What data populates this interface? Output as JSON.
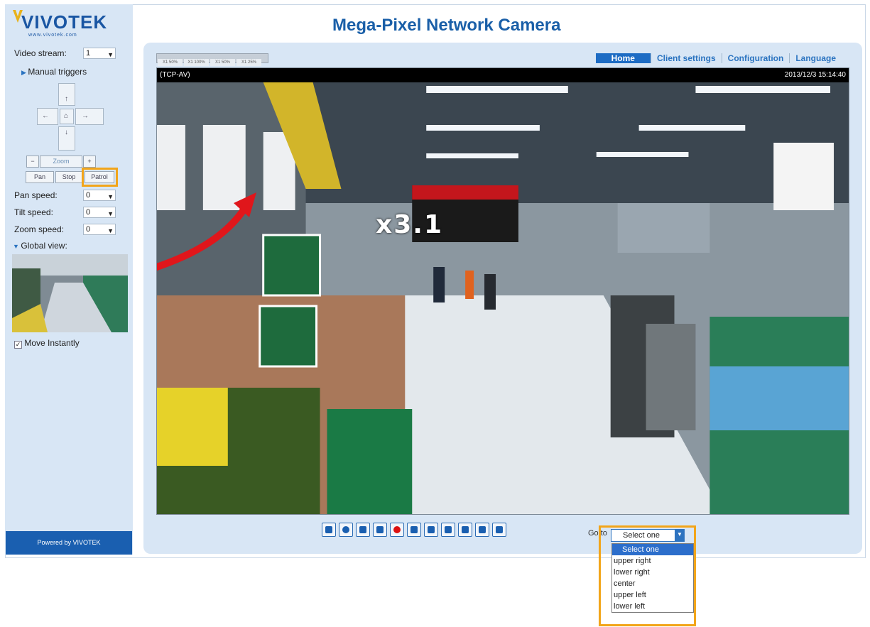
{
  "brand": {
    "name": "VIVOTEK",
    "url": "www.vivotek.com"
  },
  "page_title": "Mega-Pixel Network Camera",
  "left": {
    "video_stream_label": "Video stream:",
    "video_stream_value": "1",
    "manual_triggers": "Manual triggers",
    "zoom_label": "Zoom",
    "zoom_minus": "−",
    "zoom_plus": "+",
    "pan_btn": "Pan",
    "stop_btn": "Stop",
    "patrol_btn": "Patrol",
    "pan_speed_label": "Pan speed:",
    "pan_speed_value": "0",
    "tilt_speed_label": "Tilt speed:",
    "tilt_speed_value": "0",
    "zoom_speed_label": "Zoom speed:",
    "zoom_speed_value": "0",
    "global_view": "Global view:",
    "move_instantly": "Move Instantly",
    "move_instantly_checked": true,
    "powered_by": "Powered by VIVOTEK"
  },
  "size_tabs": [
    "X1 50%",
    "X1 100%",
    "X1 50%",
    "X1 25%"
  ],
  "nav": [
    "Home",
    "Client settings",
    "Configuration",
    "Language"
  ],
  "viewer": {
    "protocol": "(TCP-AV)",
    "timestamp": "2013/12/3 15:14:40",
    "zoom_factor": "x3.1"
  },
  "toolbar_icons": [
    "snapshot-icon",
    "digital-zoom-icon",
    "pause-icon",
    "stop-icon",
    "record-icon",
    "volume-icon",
    "mute-icon",
    "talk-icon",
    "mic-volume-icon",
    "mic-icon",
    "fullscreen-icon"
  ],
  "goto": {
    "label": "Go to",
    "value": "Select one",
    "options": [
      "Select one",
      "upper right",
      "lower right",
      "center",
      "upper left",
      "lower left"
    ]
  },
  "colors": {
    "accent": "#1a5fb0",
    "highlight": "#f2a51a",
    "arrow": "#e0161b"
  }
}
